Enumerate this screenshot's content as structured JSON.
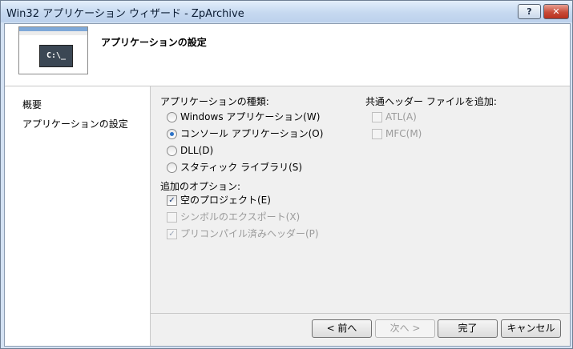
{
  "window": {
    "title": "Win32 アプリケーション ウィザード - ZpArchive",
    "help_label": "?",
    "close_label": "✕"
  },
  "header": {
    "title": "アプリケーションの設定",
    "thumbnail_prompt": "C:\\_"
  },
  "sidebar": {
    "items": [
      {
        "label": "概要"
      },
      {
        "label": "アプリケーションの設定"
      }
    ]
  },
  "app_type": {
    "label": "アプリケーションの種類:",
    "options": [
      {
        "label": "Windows アプリケーション(W)",
        "selected": false
      },
      {
        "label": "コンソール アプリケーション(O)",
        "selected": true
      },
      {
        "label": "DLL(D)",
        "selected": false
      },
      {
        "label": "スタティック ライブラリ(S)",
        "selected": false
      }
    ]
  },
  "additional_options": {
    "label": "追加のオプション:",
    "options": [
      {
        "label": "空のプロジェクト(E)",
        "checked": true,
        "enabled": true
      },
      {
        "label": "シンボルのエクスポート(X)",
        "checked": false,
        "enabled": false
      },
      {
        "label": "プリコンパイル済みヘッダー(P)",
        "checked": true,
        "enabled": false
      }
    ]
  },
  "common_headers": {
    "label": "共通ヘッダー ファイルを追加:",
    "options": [
      {
        "label": "ATL(A)",
        "checked": false,
        "enabled": false
      },
      {
        "label": "MFC(M)",
        "checked": false,
        "enabled": false
      }
    ]
  },
  "buttons": {
    "back": "< 前へ",
    "next": "次へ >",
    "finish": "完了",
    "cancel": "キャンセル"
  },
  "check_glyph": "✓"
}
